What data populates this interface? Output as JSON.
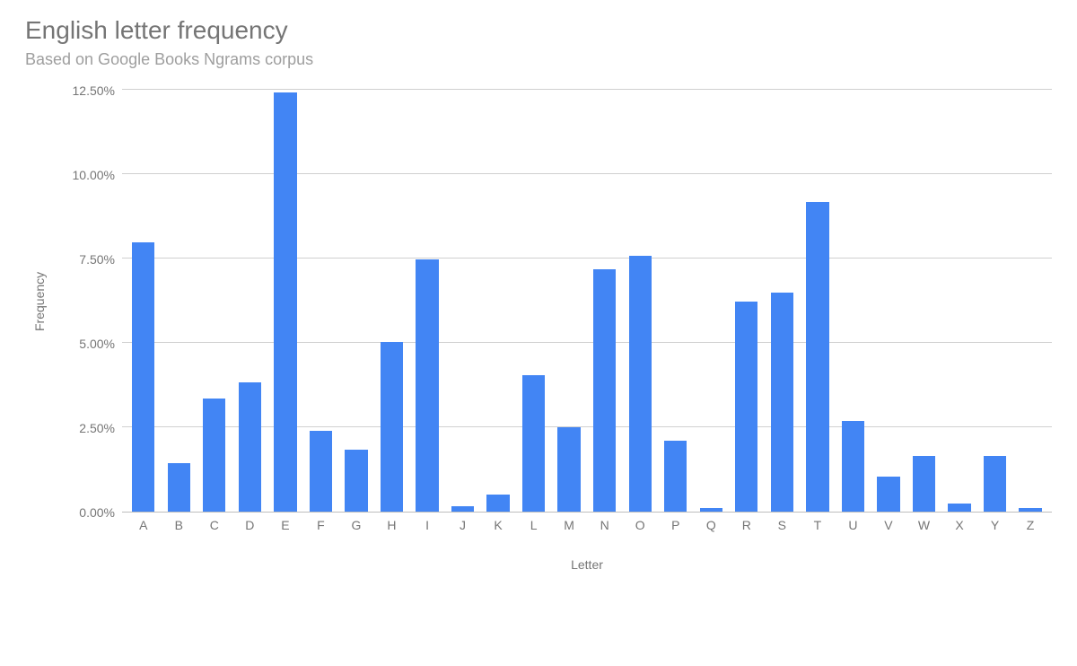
{
  "chart_data": {
    "type": "bar",
    "title": "English letter frequency",
    "subtitle": "Based on Google Books Ngrams corpus",
    "xlabel": "Letter",
    "ylabel": "Frequency",
    "categories": [
      "A",
      "B",
      "C",
      "D",
      "E",
      "F",
      "G",
      "H",
      "I",
      "J",
      "K",
      "L",
      "M",
      "N",
      "O",
      "P",
      "Q",
      "R",
      "S",
      "T",
      "U",
      "V",
      "W",
      "X",
      "Y",
      "Z"
    ],
    "values": [
      8.0,
      1.45,
      3.35,
      3.85,
      12.45,
      2.4,
      1.85,
      5.05,
      7.5,
      0.15,
      0.5,
      4.05,
      2.5,
      7.2,
      7.6,
      2.1,
      0.1,
      6.25,
      6.5,
      9.2,
      2.7,
      1.05,
      1.65,
      0.25,
      1.65,
      0.1
    ],
    "ylim": [
      0,
      12.5
    ],
    "y_ticks": [
      0.0,
      2.5,
      5.0,
      7.5,
      10.0,
      12.5
    ],
    "y_tick_labels": [
      "0.00%",
      "2.50%",
      "5.00%",
      "7.50%",
      "10.00%",
      "12.50%"
    ],
    "bar_color": "#4285f4"
  }
}
